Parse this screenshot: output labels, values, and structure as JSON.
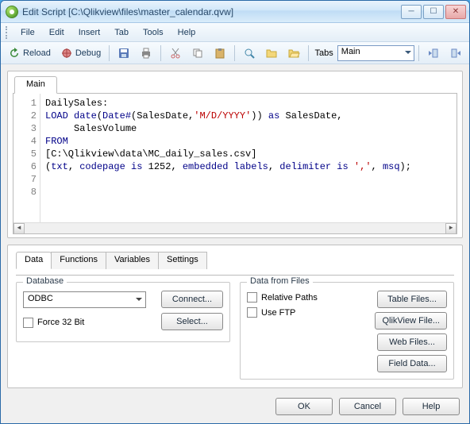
{
  "window": {
    "title": "Edit Script [C:\\Qlikview\\files\\master_calendar.qvw]"
  },
  "menu": {
    "file": "File",
    "edit": "Edit",
    "insert": "Insert",
    "tab": "Tab",
    "tools": "Tools",
    "help": "Help"
  },
  "toolbar": {
    "reload": "Reload",
    "debug": "Debug",
    "tabs_label": "Tabs",
    "tabs_value": "Main"
  },
  "editor": {
    "tab": "Main",
    "lines": [
      "1",
      "2",
      "3",
      "4",
      "5",
      "6",
      "7",
      "8"
    ],
    "code": {
      "l1": "DailySales:",
      "l2a": "LOAD",
      "l2b": " date",
      "l2c": "(",
      "l2d": "Date#",
      "l2e": "(SalesDate,",
      "l2f": "'M/D/YYYY'",
      "l2g": ")) ",
      "l2h": "as",
      "l2i": " SalesDate,",
      "l3": "     SalesVolume",
      "l4": "FROM",
      "l5": "[C:\\Qlikview\\data\\MC_daily_sales.csv]",
      "l6a": "(",
      "l6b": "txt",
      "l6c": ", ",
      "l6d": "codepage is",
      "l6e": " 1252, ",
      "l6f": "embedded labels",
      "l6g": ", ",
      "l6h": "delimiter is",
      "l6i": " ",
      "l6j": "','",
      "l6k": ", ",
      "l6l": "msq",
      "l6m": ");"
    }
  },
  "bottom": {
    "tabs": {
      "data": "Data",
      "functions": "Functions",
      "variables": "Variables",
      "settings": "Settings"
    },
    "database": {
      "legend": "Database",
      "type": "ODBC",
      "connect": "Connect...",
      "select": "Select...",
      "force32": "Force 32 Bit"
    },
    "files": {
      "legend": "Data from Files",
      "relative": "Relative Paths",
      "ftp": "Use FTP",
      "table": "Table Files...",
      "qlik": "QlikView File...",
      "web": "Web Files...",
      "field": "Field Data..."
    }
  },
  "dialog": {
    "ok": "OK",
    "cancel": "Cancel",
    "help": "Help"
  }
}
